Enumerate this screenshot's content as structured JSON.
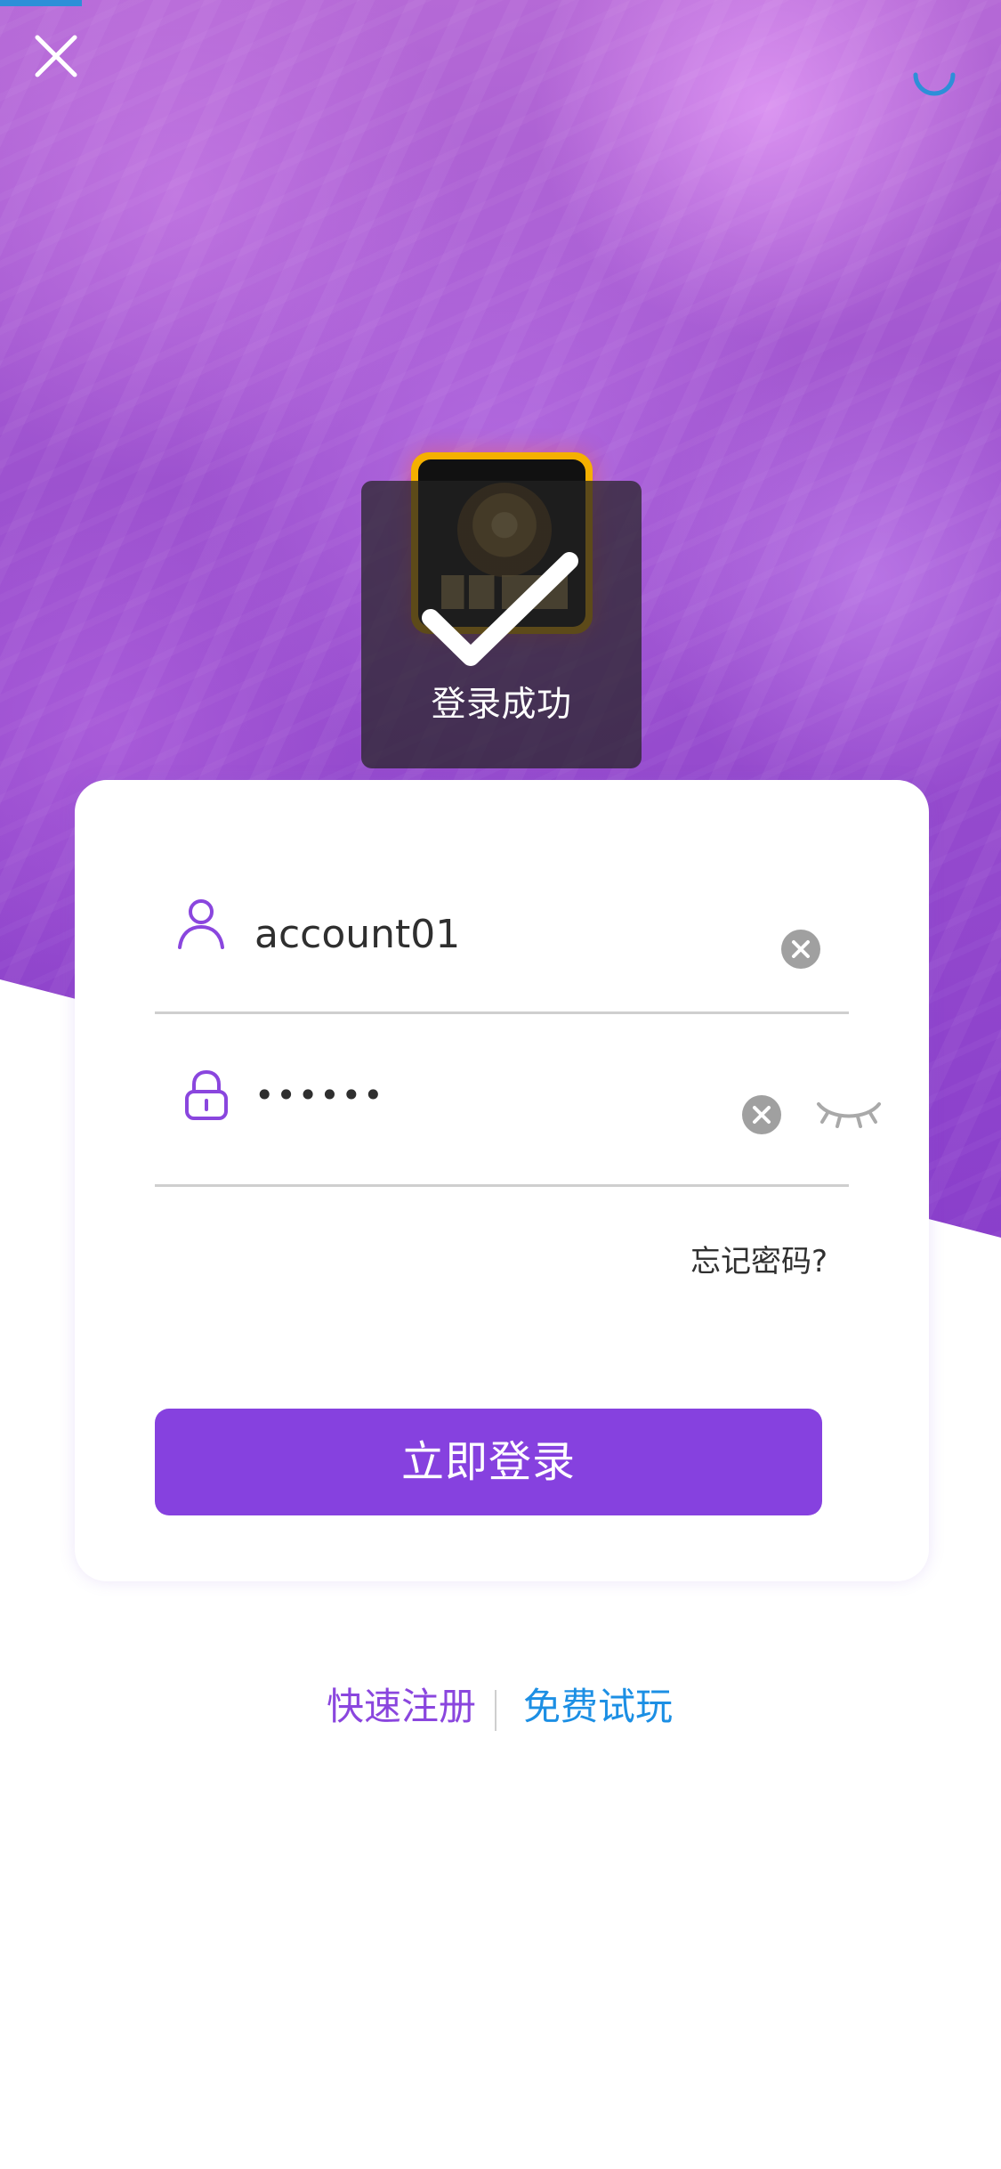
{
  "header": {
    "close_icon": "close-icon",
    "loading_icon": "loading-spinner-icon",
    "progress_color": "#2d8fd8"
  },
  "toast": {
    "message": "登录成功",
    "icon": "check-icon"
  },
  "login": {
    "username_value": "account01",
    "password_value": "••••••",
    "user_icon": "user-icon",
    "lock_icon": "lock-icon",
    "clear_icon": "clear-icon",
    "eye_icon": "eye-closed-icon",
    "forgot_password": "忘记密码?",
    "submit_label": "立即登录"
  },
  "footer": {
    "quick_register": "快速注册",
    "free_trial": "免费试玩"
  },
  "colors": {
    "accent_purple": "#8641df",
    "link_purple": "#8a46de",
    "link_blue": "#1c8fe4",
    "overlay": "#222222"
  }
}
